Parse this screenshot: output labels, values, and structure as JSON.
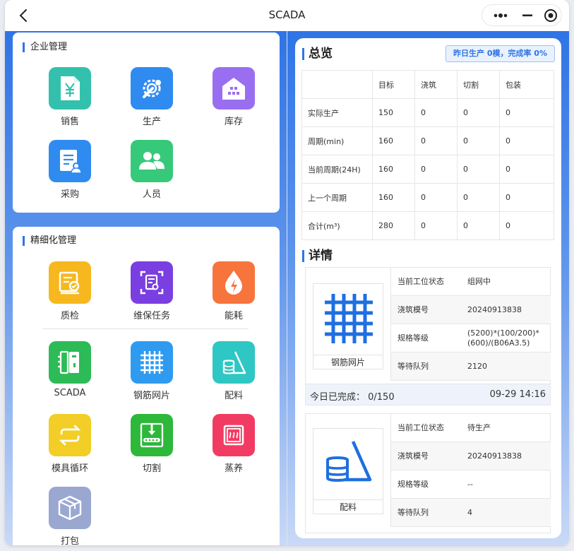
{
  "window": {
    "title": "SCADA"
  },
  "enterprise": {
    "title": "企业管理",
    "tiles": [
      {
        "label": "销售",
        "icon": "yen-document-icon",
        "color": "#33c1ad"
      },
      {
        "label": "生产",
        "icon": "gear-wrench-icon",
        "color": "#2f8bf0"
      },
      {
        "label": "库存",
        "icon": "warehouse-icon",
        "color": "#9a6ef0"
      },
      {
        "label": "采购",
        "icon": "purchase-document-icon",
        "color": "#2f8bf0"
      },
      {
        "label": "人员",
        "icon": "people-icon",
        "color": "#36c97a"
      }
    ]
  },
  "fine": {
    "title": "精细化管理",
    "tiles": [
      {
        "label": "质检",
        "icon": "quality-inspect-icon",
        "color": "#f6b81e"
      },
      {
        "label": "维保任务",
        "icon": "maintenance-task-icon",
        "color": "#7a3fe0"
      },
      {
        "label": "能耗",
        "icon": "energy-drop-icon",
        "color": "#f7743d"
      },
      {
        "label": "SCADA",
        "icon": "scada-panel-icon",
        "color": "#2dbb57"
      },
      {
        "label": "钢筋网片",
        "icon": "rebar-mesh-icon",
        "color": "#2f9bf0"
      },
      {
        "label": "配料",
        "icon": "batching-icon",
        "color": "#2ec7c4"
      },
      {
        "label": "模具循环",
        "icon": "cycle-icon",
        "color": "#f2ce26"
      },
      {
        "label": "切割",
        "icon": "cutting-machine-icon",
        "color": "#2db83a"
      },
      {
        "label": "蒸养",
        "icon": "steam-cure-icon",
        "color": "#f23b62"
      },
      {
        "label": "打包",
        "icon": "package-box-icon",
        "color": "#9aa7d1"
      }
    ]
  },
  "overview": {
    "title": "总览",
    "yesterday": "昨日生产 0模，完成率 0%",
    "headers": [
      "",
      "目标",
      "浇筑",
      "切割",
      "包装"
    ],
    "rows": [
      [
        "实际生产",
        "150",
        "0",
        "0",
        "0"
      ],
      [
        "周期(min)",
        "160",
        "0",
        "0",
        "0"
      ],
      [
        "当前周期(24H)",
        "160",
        "0",
        "0",
        "0"
      ],
      [
        "上一个周期",
        "160",
        "0",
        "0",
        "0"
      ],
      [
        "合计(m³)",
        "280",
        "0",
        "0",
        "0"
      ]
    ]
  },
  "details": {
    "title": "详情",
    "cards": [
      {
        "image_label": "钢筋网片",
        "icon": "rebar-mesh-icon",
        "rows": [
          {
            "k": "当前工位状态",
            "v": "组网中"
          },
          {
            "k": "浇筑模号",
            "v": "20240913838"
          },
          {
            "k": "规格等级",
            "v": "(5200)*(100/200)*(600)/(B06A3.5)"
          },
          {
            "k": "等待队列",
            "v": "2120"
          }
        ],
        "footer_left": "今日已完成： 0/150",
        "footer_right": "09-29 14:16"
      },
      {
        "image_label": "配料",
        "icon": "batching-icon",
        "rows": [
          {
            "k": "当前工位状态",
            "v": "待生产"
          },
          {
            "k": "浇筑模号",
            "v": "20240913838"
          },
          {
            "k": "规格等级",
            "v": "--"
          },
          {
            "k": "等待队列",
            "v": "4"
          }
        ]
      }
    ]
  }
}
